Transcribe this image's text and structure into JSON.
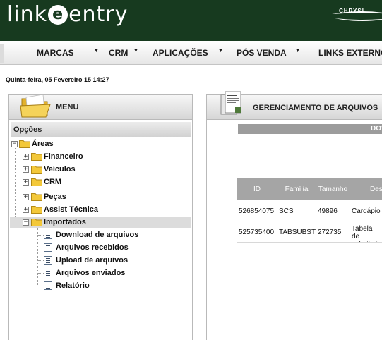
{
  "header": {
    "logo_left": "link",
    "logo_e": "e",
    "logo_right": "entry",
    "brand_text": "CHRYSL"
  },
  "nav": {
    "items": [
      {
        "label": "MARCAS"
      },
      {
        "label": "CRM"
      },
      {
        "label": "APLICAÇÕES"
      },
      {
        "label": "PÓS VENDA"
      },
      {
        "label": "LINKS EXTERNO"
      }
    ],
    "arrow": "▼"
  },
  "datetime": "Quinta-feira, 05 Fevereiro 15 14:27",
  "left_panel": {
    "title": "MENU",
    "section": "Opções",
    "tree": {
      "root": "Áreas",
      "expander_minus": "−",
      "expander_plus": "+",
      "folders": [
        {
          "label": "Financeiro"
        },
        {
          "label": "Veículos"
        },
        {
          "label": "CRM"
        },
        {
          "label": "Peças"
        },
        {
          "label": "Assist Técnica"
        },
        {
          "label": "Importados"
        }
      ],
      "files": [
        {
          "label": "Download de arquivos"
        },
        {
          "label": "Arquivos recebidos"
        },
        {
          "label": "Upload de arquivos"
        },
        {
          "label": "Arquivos enviados"
        },
        {
          "label": "Relatório"
        }
      ]
    }
  },
  "right_panel": {
    "title": "GERENCIAMENTO DE ARQUIVOS",
    "download_bar": "DOV",
    "table": {
      "headers": [
        "ID",
        "Família",
        "Tamanho",
        "Des"
      ],
      "rows": [
        [
          "526854075",
          "SCS",
          "49896",
          "Cardápio"
        ],
        [
          "525735400",
          "TABSUBST",
          "272735",
          "Tabela de substituiç"
        ]
      ]
    }
  },
  "colors": {
    "header_green": "#173a1f",
    "table_header_gray": "#a5a5a5",
    "folder_yellow": "#f3c83a"
  }
}
